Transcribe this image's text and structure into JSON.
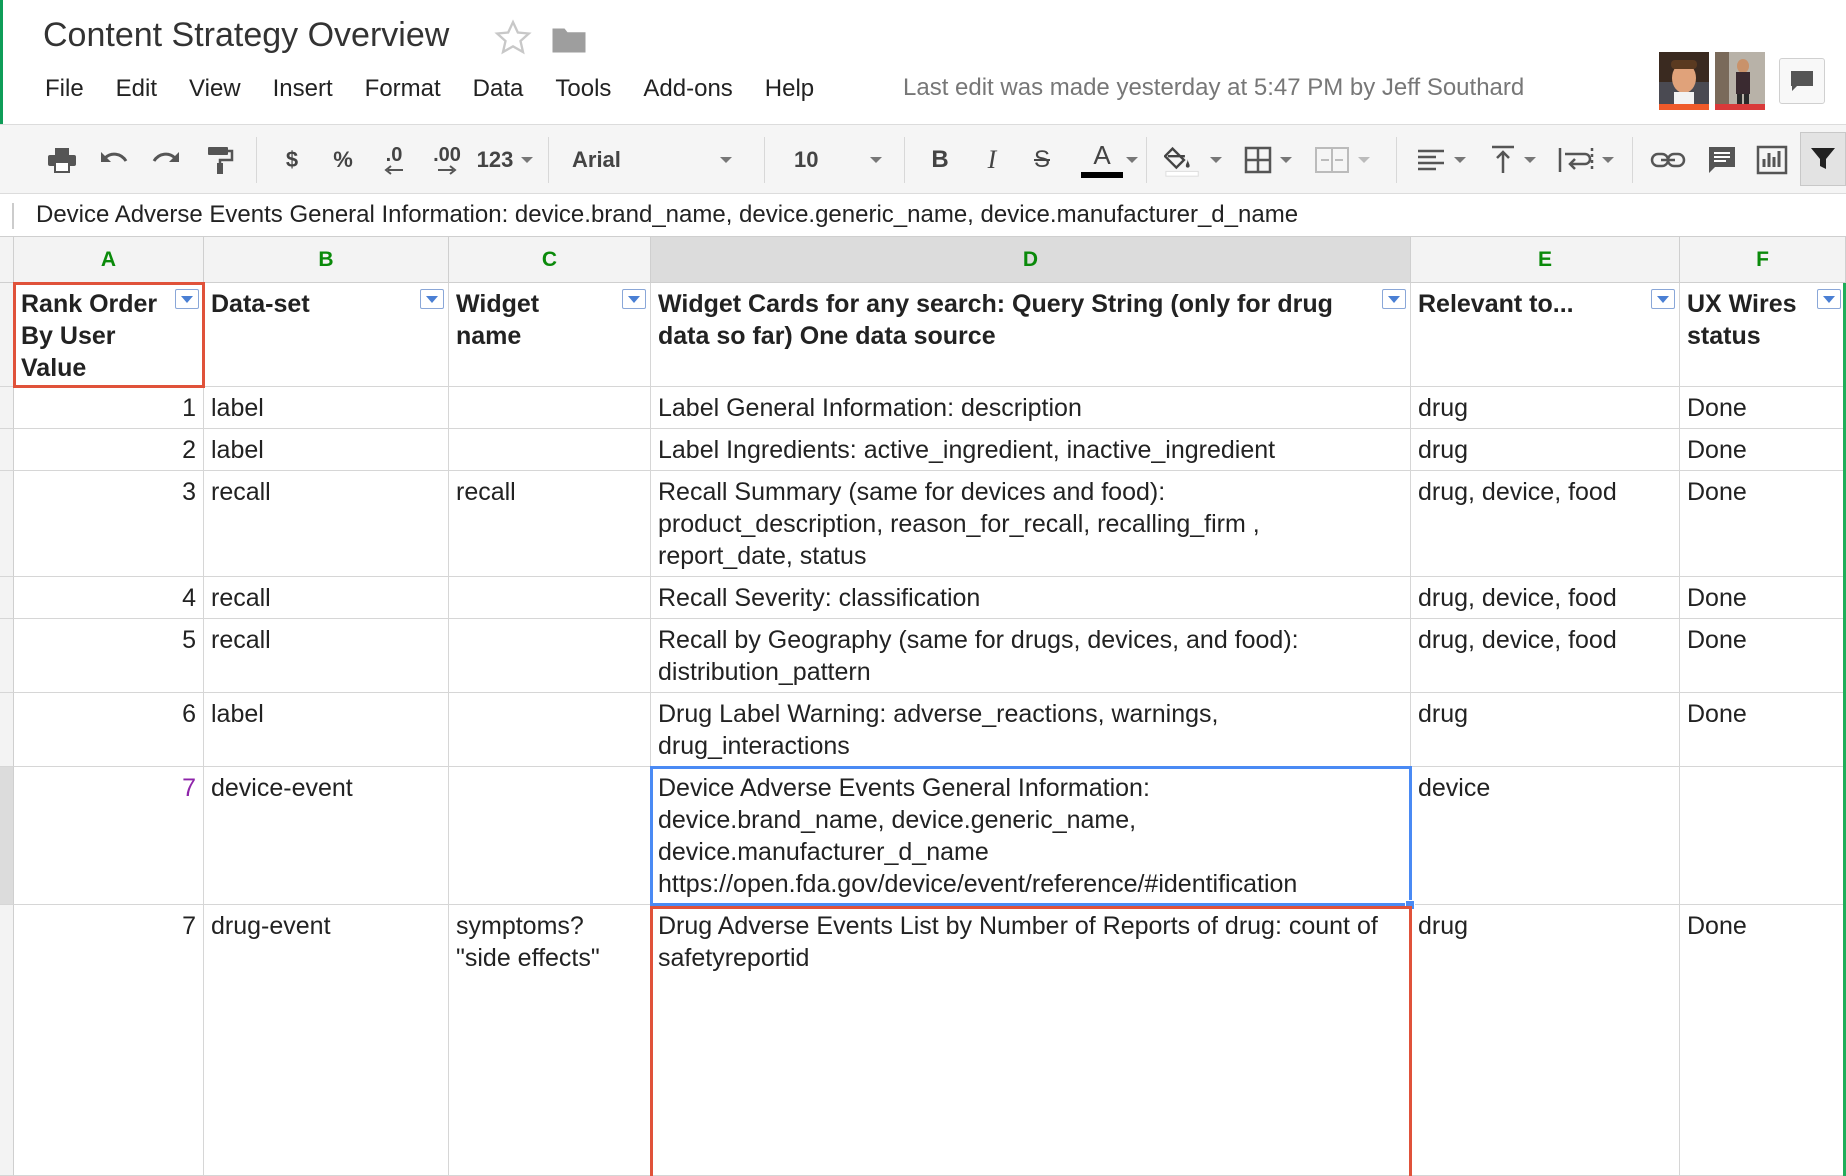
{
  "document": {
    "title": "Content Strategy Overview",
    "last_edit": "Last edit was made yesterday at 5:47 PM by Jeff Southard"
  },
  "menu": [
    "File",
    "Edit",
    "View",
    "Insert",
    "Format",
    "Data",
    "Tools",
    "Add-ons",
    "Help"
  ],
  "toolbar": {
    "currency_label": "$",
    "percent_label": "%",
    "decrease_decimals_label": ".0",
    "increase_decimals_label": ".00",
    "more_formats_label": "123",
    "font_name": "Arial",
    "font_size": "10",
    "bold_label": "B",
    "italic_label": "I",
    "strikethrough_label": "S",
    "text_color_label": "A"
  },
  "formula_bar": {
    "content": "Device Adverse Events General Information:  device.brand_name, device.generic_name, device.manufacturer_d_name"
  },
  "columns": [
    "A",
    "B",
    "C",
    "D",
    "E",
    "F"
  ],
  "header_row": [
    "Rank Order By User Value",
    "Data-set",
    "Widget name",
    "Widget Cards for any search: Query String (only for drug data so far) One data source",
    "Relevant to...",
    "UX Wires status"
  ],
  "rows": [
    [
      "1",
      "label",
      "",
      "Label General Information: description",
      "drug",
      "Done"
    ],
    [
      "2",
      "label",
      "",
      "Label Ingredients: active_ingredient, inactive_ingredient",
      "drug",
      "Done"
    ],
    [
      "3",
      "recall",
      "recall",
      "Recall Summary (same for devices and food): product_description, reason_for_recall, recalling_firm , report_date, status",
      "drug, device, food",
      "Done"
    ],
    [
      "4",
      "recall",
      "",
      "Recall Severity: classification",
      "drug, device, food",
      "Done"
    ],
    [
      "5",
      "recall",
      "",
      "Recall by Geography (same for drugs, devices, and food): distribution_pattern",
      "drug, device, food",
      "Done"
    ],
    [
      "6",
      "label",
      "",
      "Drug Label Warning: adverse_reactions, warnings, drug_interactions",
      "drug",
      "Done"
    ],
    [
      "7",
      "device-event",
      "",
      "Device Adverse Events General Information: device.brand_name, device.generic_name, device.manufacturer_d_name https://open.fda.gov/device/event/reference/#identification",
      "device",
      ""
    ],
    [
      "7",
      "drug-event",
      "symptoms? \"side effects\"",
      "Drug Adverse Events List by Number of Reports of drug: count of safetyreportid",
      "drug",
      "Done"
    ]
  ],
  "colors": {
    "accent_green": "#0a8a0a",
    "selection_blue": "#4a8af4",
    "highlight_red": "#e0523a",
    "rank_purple": "#8e24aa"
  }
}
